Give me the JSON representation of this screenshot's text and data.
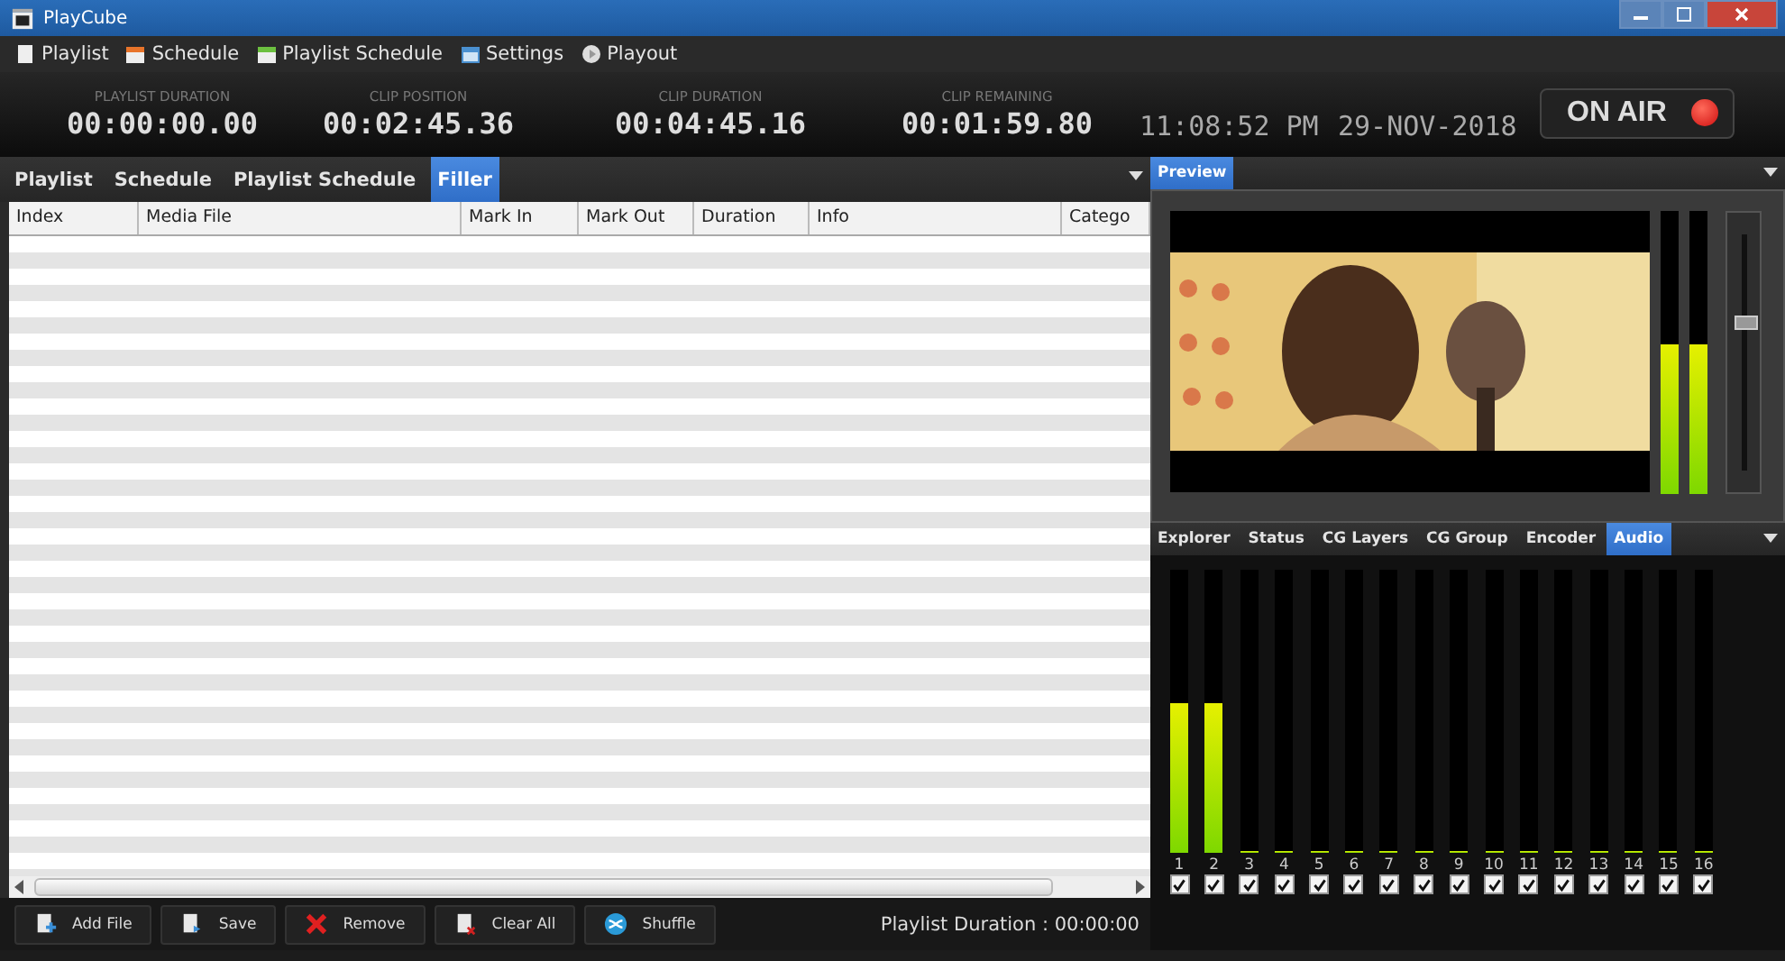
{
  "window": {
    "title": "PlayCube"
  },
  "menu": [
    {
      "label": "Playlist",
      "kind": "page"
    },
    {
      "label": "Schedule",
      "kind": "calendar"
    },
    {
      "label": "Playlist Schedule",
      "kind": "calendar-green"
    },
    {
      "label": "Settings",
      "kind": "window"
    },
    {
      "label": "Playout",
      "kind": "disc"
    }
  ],
  "counters": [
    {
      "label": "PLAYLIST DURATION",
      "value": "00:00:00.00"
    },
    {
      "label": "CLIP POSITION",
      "value": "00:02:45.36"
    },
    {
      "label": "CLIP DURATION",
      "value": "00:04:45.16"
    },
    {
      "label": "CLIP REMAINING",
      "value": "00:01:59.80"
    }
  ],
  "clock": {
    "time": "11:08:52 PM",
    "date": "29-NOV-2018"
  },
  "on_air": {
    "label": "ON AIR",
    "on": true
  },
  "left_tabs": [
    {
      "label": "Playlist",
      "selected": false
    },
    {
      "label": "Schedule",
      "selected": false
    },
    {
      "label": "Playlist Schedule",
      "selected": false
    },
    {
      "label": "Filler",
      "selected": true
    }
  ],
  "table": {
    "columns": [
      "Index",
      "Media File",
      "Mark In",
      "Mark Out",
      "Duration",
      "Info",
      "Catego"
    ]
  },
  "toolbar": [
    {
      "label": "Add File",
      "kind": "add"
    },
    {
      "label": "Save",
      "kind": "save"
    },
    {
      "label": "Remove",
      "kind": "remove"
    },
    {
      "label": "Clear All",
      "kind": "clear"
    },
    {
      "label": "Shuffle",
      "kind": "shuffle"
    }
  ],
  "status": "Playlist Duration : 00:00:00",
  "preview": {
    "tab": {
      "label": "Preview",
      "selected": true
    },
    "meters": [
      {
        "level": 0.53
      },
      {
        "level": 0.53
      }
    ],
    "slider": {
      "level": 0.62
    }
  },
  "bottom_tabs": [
    {
      "label": "Explorer",
      "selected": false
    },
    {
      "label": "Status",
      "selected": false
    },
    {
      "label": "CG Layers",
      "selected": false
    },
    {
      "label": "CG Group",
      "selected": false
    },
    {
      "label": "Encoder",
      "selected": false
    },
    {
      "label": "Audio",
      "selected": true
    }
  ],
  "audio_channels": [
    {
      "label": "1",
      "level": 0.53,
      "checked": true
    },
    {
      "label": "2",
      "level": 0.53,
      "checked": true
    },
    {
      "label": "3",
      "level": 0,
      "checked": true
    },
    {
      "label": "4",
      "level": 0,
      "checked": true
    },
    {
      "label": "5",
      "level": 0,
      "checked": true
    },
    {
      "label": "6",
      "level": 0,
      "checked": true
    },
    {
      "label": "7",
      "level": 0,
      "checked": true
    },
    {
      "label": "8",
      "level": 0,
      "checked": true
    },
    {
      "label": "9",
      "level": 0,
      "checked": true
    },
    {
      "label": "10",
      "level": 0,
      "checked": true
    },
    {
      "label": "11",
      "level": 0,
      "checked": true
    },
    {
      "label": "12",
      "level": 0,
      "checked": true
    },
    {
      "label": "13",
      "level": 0,
      "checked": true
    },
    {
      "label": "14",
      "level": 0,
      "checked": true
    },
    {
      "label": "15",
      "level": 0,
      "checked": true
    },
    {
      "label": "16",
      "level": 0,
      "checked": true
    }
  ]
}
